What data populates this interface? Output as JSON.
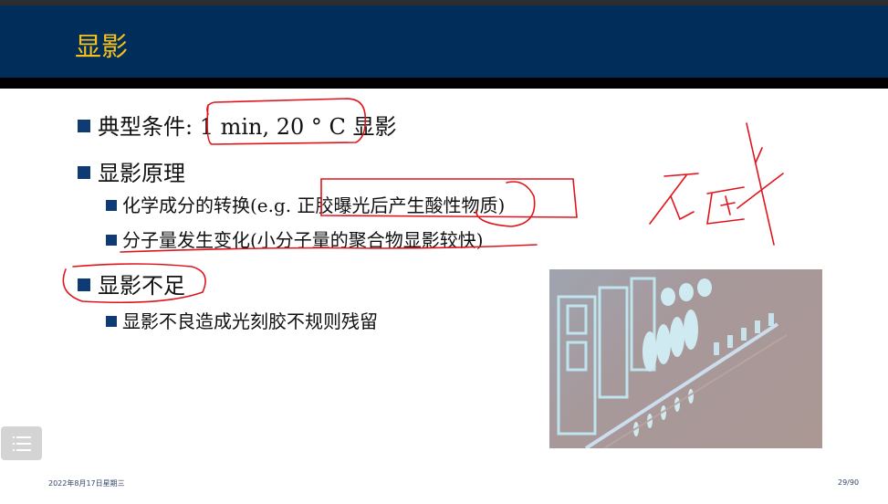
{
  "slide": {
    "title": "显影",
    "bullets": [
      {
        "text": "典型条件: 1 min, 20 ° C  显影"
      },
      {
        "text": "显影原理",
        "sub": [
          "化学成分的转换(e.g. 正胶曝光后产生酸性物质)",
          "分子量发生变化(小分子量的聚合物显影较快)"
        ]
      },
      {
        "text": "显影不足",
        "sub": [
          "显影不良造成光刻胶不规则残留"
        ]
      }
    ],
    "handwriting": "碱"
  },
  "footer": {
    "date": "2022年8月17日星期三",
    "page": "29/90"
  },
  "colors": {
    "header": "#002d5a",
    "title": "#f7c11a",
    "bullet": "#0e3b73",
    "annotation": "#e0141c"
  },
  "icons": {
    "menu": "list-menu-icon"
  }
}
